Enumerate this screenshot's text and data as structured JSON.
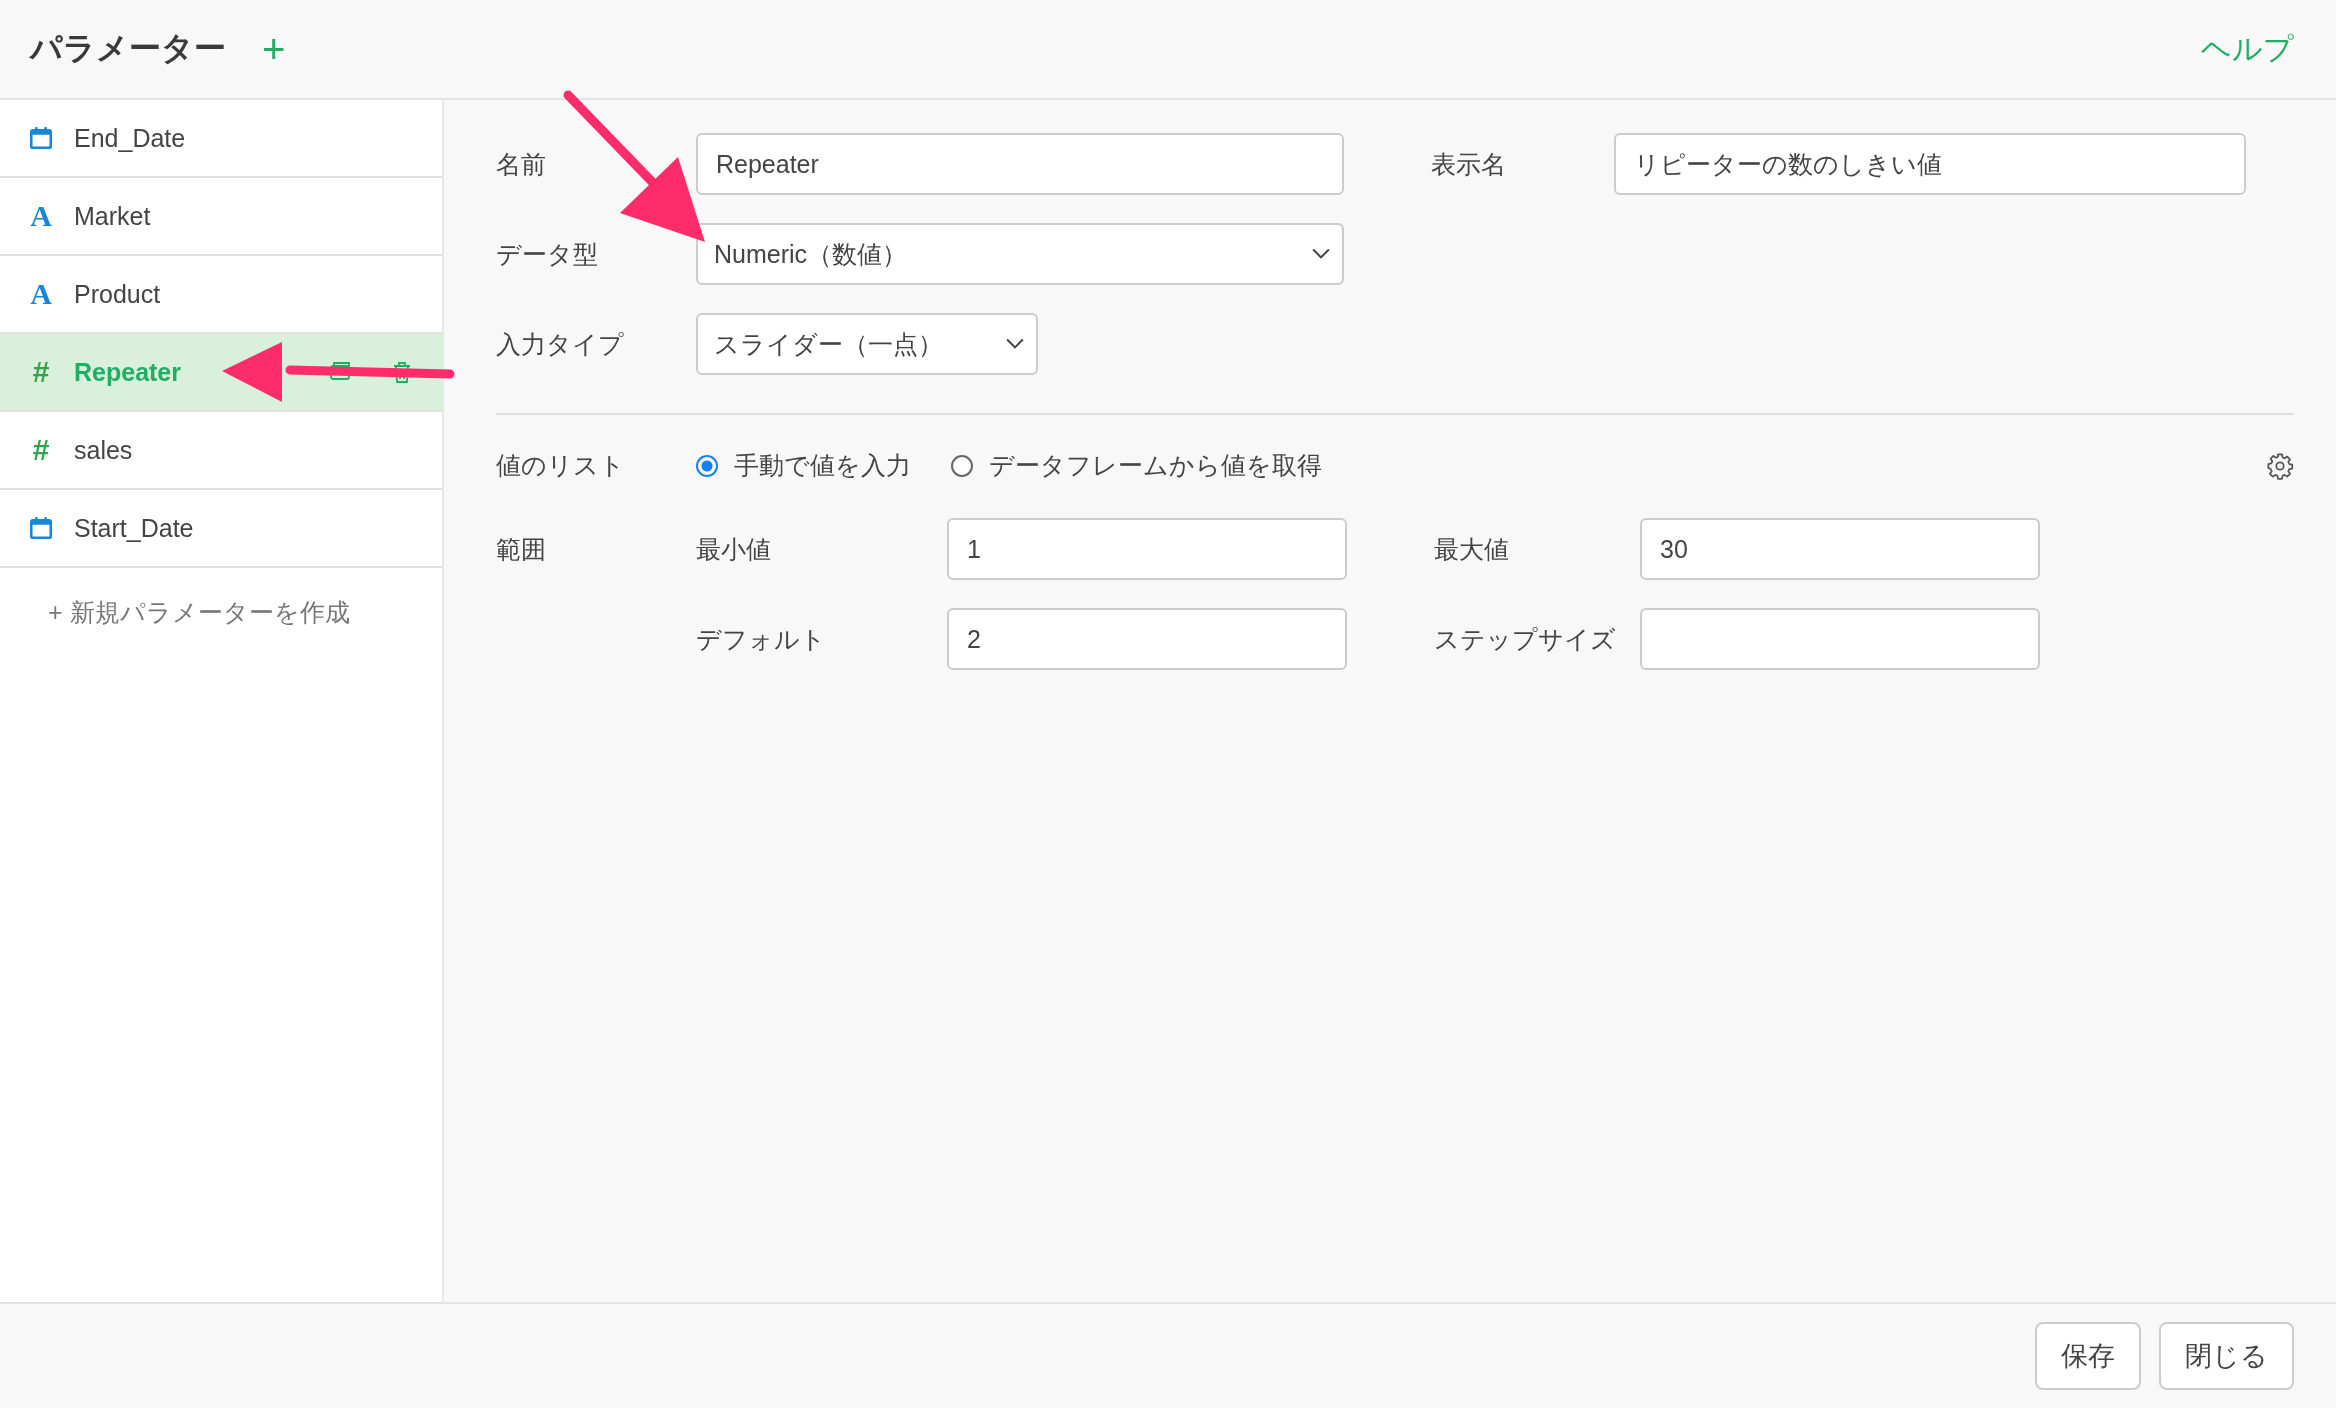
{
  "header": {
    "title": "パラメーター",
    "add": "+",
    "help": "ヘルプ"
  },
  "sidebar": {
    "items": [
      {
        "kind": "date",
        "label": "End_Date",
        "selected": false
      },
      {
        "kind": "text",
        "icon": "A",
        "label": "Market",
        "selected": false
      },
      {
        "kind": "text",
        "icon": "A",
        "label": "Product",
        "selected": false
      },
      {
        "kind": "number",
        "icon": "#",
        "label": "Repeater",
        "selected": true
      },
      {
        "kind": "number",
        "icon": "#",
        "label": "sales",
        "selected": false
      },
      {
        "kind": "date",
        "label": "Start_Date",
        "selected": false
      }
    ],
    "create": {
      "icon": "+",
      "label": "新規パラメーターを作成"
    }
  },
  "form": {
    "name": {
      "label": "名前",
      "value": "Repeater"
    },
    "display_name": {
      "label": "表示名",
      "value": "リピーターの数のしきい値"
    },
    "data_type": {
      "label": "データ型",
      "value": "Numeric（数値）"
    },
    "input_type": {
      "label": "入力タイプ",
      "value": "スライダー（一点）"
    },
    "value_list": {
      "label": "値のリスト",
      "options": [
        {
          "label": "手動で値を入力",
          "selected": true
        },
        {
          "label": "データフレームから値を取得",
          "selected": false
        }
      ]
    },
    "range": {
      "label": "範囲",
      "min": {
        "label": "最小値",
        "value": "1"
      },
      "max": {
        "label": "最大値",
        "value": "30"
      },
      "default": {
        "label": "デフォルト",
        "value": "2"
      },
      "step": {
        "label": "ステップサイズ"
      }
    }
  },
  "footer": {
    "buttons": [
      "保存",
      "閉じる"
    ]
  }
}
